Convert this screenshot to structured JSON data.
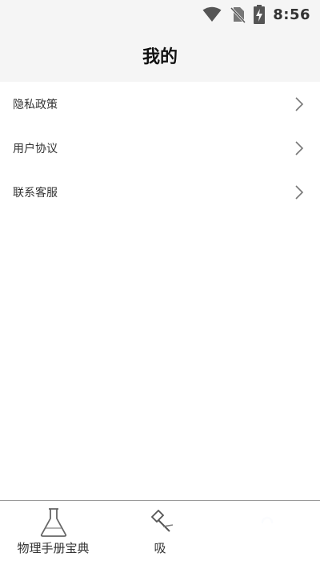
{
  "status_bar": {
    "time": "8:56",
    "icons": [
      "wifi-icon",
      "no-sim-icon",
      "battery-charging-icon"
    ]
  },
  "header": {
    "title": "我的"
  },
  "menu": {
    "items": [
      {
        "label": "隐私政策",
        "icon": "chevron-right-icon"
      },
      {
        "label": "用户协议",
        "icon": "chevron-right-icon"
      },
      {
        "label": "联系客服",
        "icon": "chevron-right-icon"
      }
    ]
  },
  "bottom_nav": {
    "items": [
      {
        "label": "物理手册宝典",
        "icon": "flask-icon"
      },
      {
        "label": "吸",
        "icon": "tool-icon"
      },
      {
        "label": "",
        "icon": "loading-icon"
      }
    ]
  },
  "colors": {
    "header_bg": "#f5f5f5",
    "accent_blue": "#4a7fd6",
    "divider": "#9a9a9a"
  }
}
